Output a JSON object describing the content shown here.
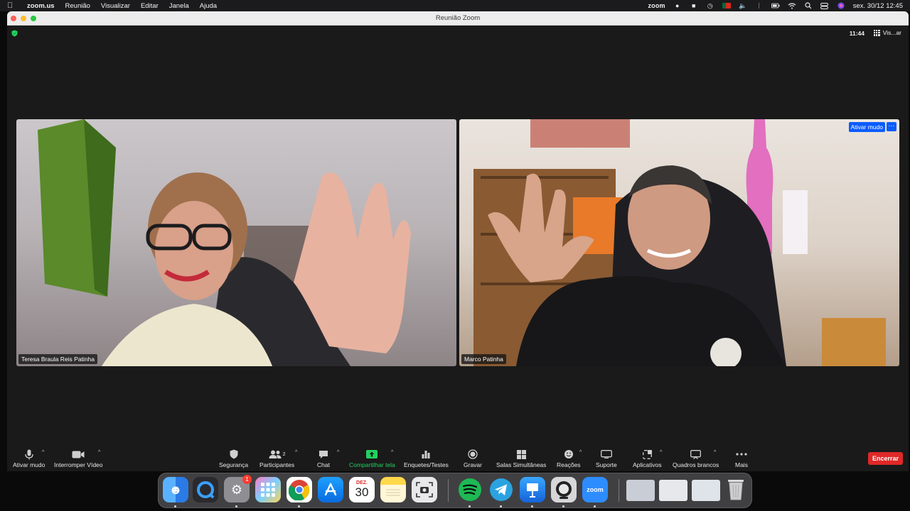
{
  "menubar": {
    "app_name": "zoom.us",
    "menus": [
      "Reunião",
      "Visualizar",
      "Editar",
      "Janela",
      "Ajuda"
    ],
    "zoom_status": "zoom",
    "datetime": "sex. 30/12  12:45"
  },
  "window": {
    "title": "Reunião Zoom",
    "clock": "11:44",
    "view_label": "Vis...ar"
  },
  "participants": [
    {
      "name": "Teresa Braula Reis Patinha"
    },
    {
      "name": "Marco Patinha",
      "unmute_label": "Ativar mudo",
      "more_label": "···"
    }
  ],
  "toolbar": {
    "mute": "Ativar mudo",
    "video": "Interromper Vídeo",
    "security": "Segurança",
    "participants": "Participantes",
    "participants_count": "2",
    "chat": "Chat",
    "share": "Compartilhar tela",
    "polls": "Enquetes/Testes",
    "record": "Gravar",
    "breakout": "Salas Simultâneas",
    "reactions": "Reações",
    "support": "Suporte",
    "apps": "Aplicativos",
    "whiteboards": "Quadros brancos",
    "more": "Mais",
    "end": "Encerrar"
  },
  "dock": {
    "settings_badge": "1",
    "calendar_month": "DEZ.",
    "calendar_day": "30",
    "zoom_label": "zoom"
  },
  "colors": {
    "share_green": "#23d160",
    "end_red": "#e02828",
    "accent_blue": "#0b5cff"
  }
}
